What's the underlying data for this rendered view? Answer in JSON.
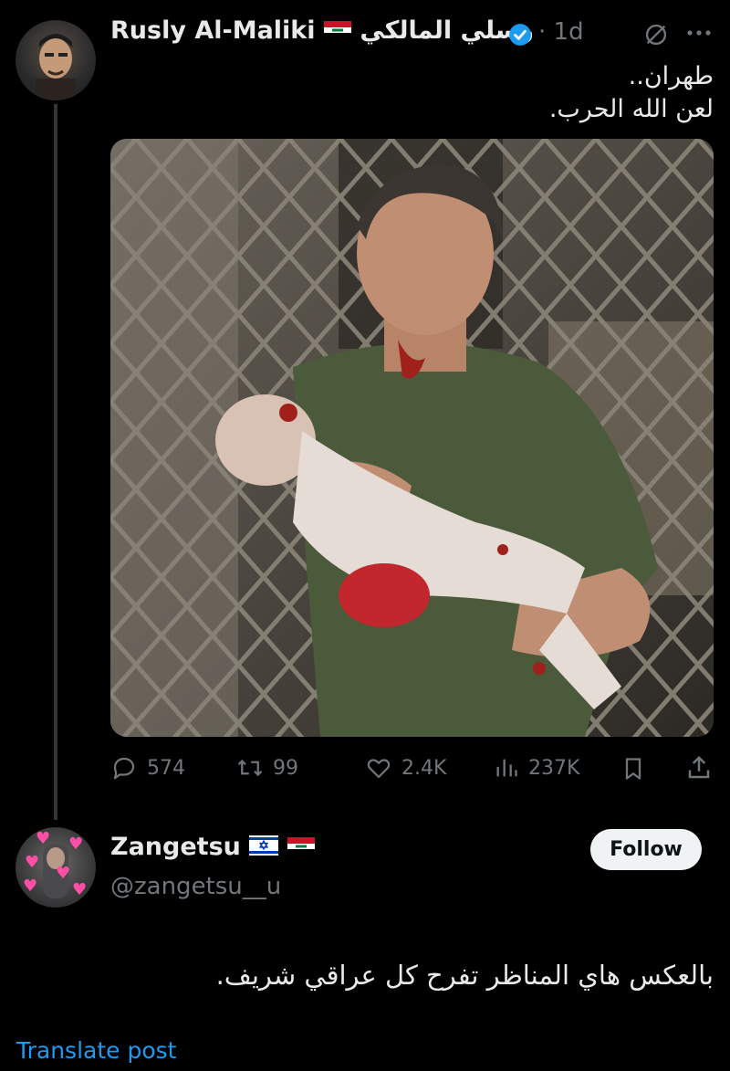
{
  "post": {
    "author_name": "Rusly Al-Maliki",
    "author_name_arabic": "رسلي المالكي",
    "timestamp": "· 1d",
    "text_line1": "طهران..",
    "text_line2": "لعن الله الحرب.",
    "media_alt": "Photo of a man carrying an injured baby in front of a damaged metal grille"
  },
  "actions": {
    "replies": "574",
    "reposts": "99",
    "likes": "2.4K",
    "views": "237K"
  },
  "reply": {
    "author_name": "Zangetsu",
    "handle": "@zangetsu__u",
    "follow_label": "Follow",
    "text": "بالعكس هاي المناظر تفرح كل عراقي شريف.",
    "translate_label": "Translate post"
  },
  "icons": [
    "verified-badge-icon",
    "grok-icon",
    "more-icon",
    "reply-icon",
    "repost-icon",
    "like-icon",
    "views-icon",
    "bookmark-icon",
    "share-icon"
  ],
  "colors": {
    "background": "#000000",
    "text": "#e7e9ea",
    "muted": "#71767b",
    "accent": "#1d9bf0",
    "thread_line": "#333639"
  }
}
